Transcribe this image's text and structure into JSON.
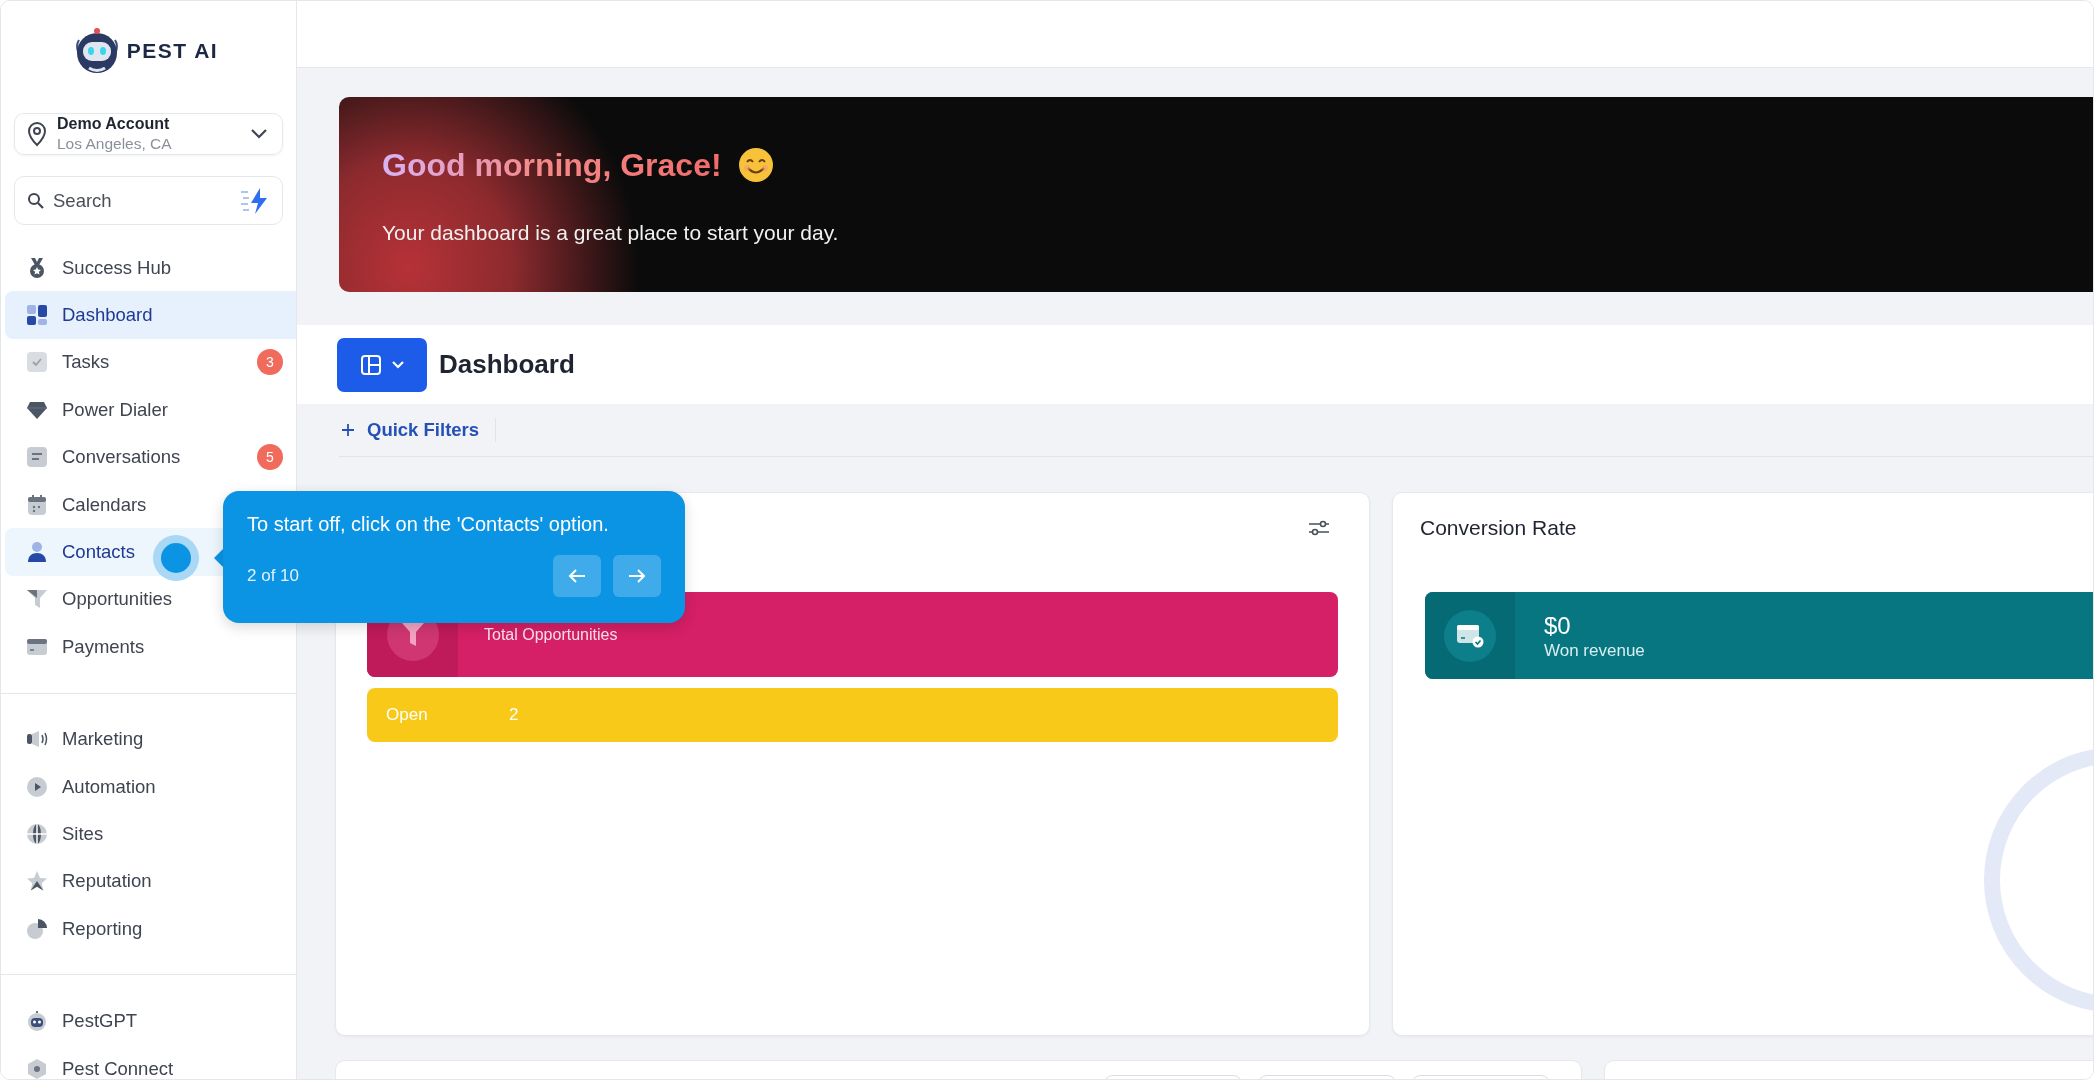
{
  "logo": {
    "text": "PEST AI"
  },
  "account": {
    "name": "Demo Account",
    "location": "Los Angeles, CA"
  },
  "search": {
    "placeholder": "Search"
  },
  "nav_sections": [
    {
      "items": [
        {
          "label": "Success Hub",
          "selected": false,
          "highlighted": false
        },
        {
          "label": "Dashboard",
          "selected": true,
          "highlighted": false
        },
        {
          "label": "Tasks",
          "selected": false,
          "highlighted": false,
          "badge": "3"
        },
        {
          "label": "Power Dialer",
          "selected": false,
          "highlighted": false
        },
        {
          "label": "Conversations",
          "selected": false,
          "highlighted": false,
          "badge": "5"
        },
        {
          "label": "Calendars",
          "selected": false,
          "highlighted": false
        },
        {
          "label": "Contacts",
          "selected": false,
          "highlighted": true
        },
        {
          "label": "Opportunities",
          "selected": false,
          "highlighted": false
        },
        {
          "label": "Payments",
          "selected": false,
          "highlighted": false
        }
      ]
    },
    {
      "items": [
        {
          "label": "Marketing",
          "selected": false,
          "highlighted": false
        },
        {
          "label": "Automation",
          "selected": false,
          "highlighted": false
        },
        {
          "label": "Sites",
          "selected": false,
          "highlighted": false
        },
        {
          "label": "Reputation",
          "selected": false,
          "highlighted": false
        },
        {
          "label": "Reporting",
          "selected": false,
          "highlighted": false
        }
      ]
    },
    {
      "items": [
        {
          "label": "PestGPT",
          "selected": false,
          "highlighted": false
        },
        {
          "label": "Pest Connect",
          "selected": false,
          "highlighted": false
        }
      ]
    }
  ],
  "greeting": {
    "title": "Good morning, Grace!",
    "subtitle": "Your dashboard is a great place to start your day."
  },
  "dashboard": {
    "title": "Dashboard",
    "quick_filters": "Quick Filters"
  },
  "opportunities_card": {
    "total": {
      "label": "Total Opportunities"
    },
    "statuses": [
      {
        "label": "Open",
        "value": "2"
      }
    ]
  },
  "conversion_card": {
    "title": "Conversion Rate",
    "revenue": {
      "value": "$0",
      "label": "Won revenue"
    }
  },
  "tour": {
    "text": "To start off, click on the 'Contacts' option.",
    "step": "2 of 10"
  }
}
